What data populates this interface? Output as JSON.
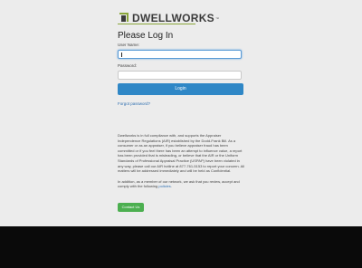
{
  "logo": {
    "text": "DWELLWORKS",
    "tm": "™"
  },
  "login": {
    "title": "Please Log In",
    "username_label": "User Name:",
    "password_label": "Password:",
    "submit_label": "Login",
    "forgot_link": "Forgot password?"
  },
  "disclaimer": {
    "paragraph1": "Dwellworks is in full compliance with, and supports the Appraiser Independence Regulations (AIR) established by the Dodd-Frank Bill. As a consumer or as an appraiser, if you believe appraiser fraud has been committed or if you feel there has been an attempt to influence value, a report has been provided that is misleading, or believe that the AIR or the Uniform Standards of Professional Appraisal Practice (USPAP) have been violated in any way, please call our AIR hotline at 877-761-5153 to report your concern. All matters will be addressed immediately and will be held as Confidential.",
    "paragraph2_prefix": "In addition, as a member of our network, we ask that you review, accept and comply with the following ",
    "paragraph2_link": "policies",
    "paragraph2_suffix": ".",
    "contact_button": "Contact Us"
  },
  "colors": {
    "primary_button": "#2f87c6",
    "contact_button": "#4caf50",
    "link": "#2f6fb0",
    "footer": "#0a0a0a"
  }
}
